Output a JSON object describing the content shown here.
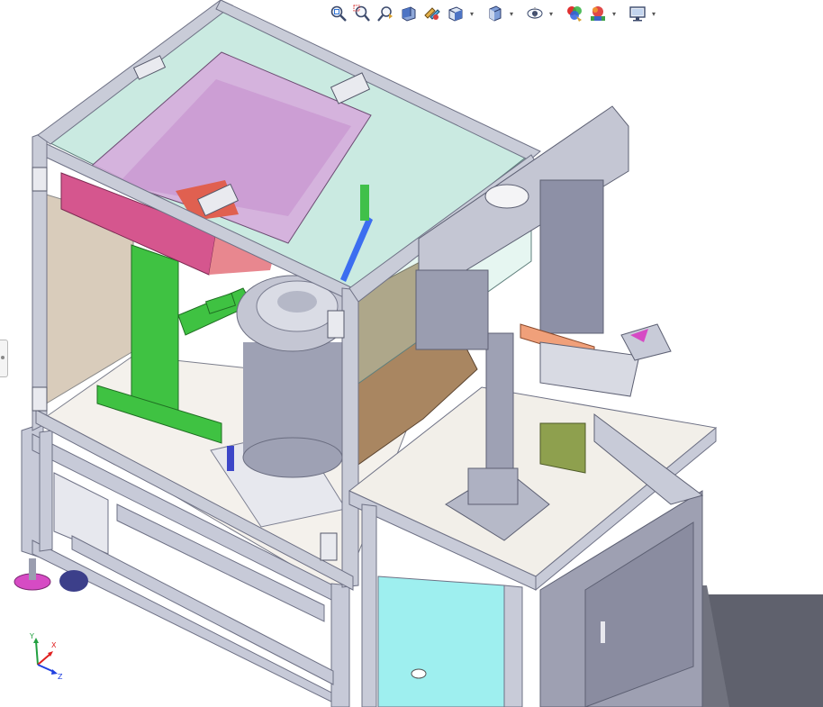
{
  "toolbar": {
    "tools": [
      {
        "id": "zoom-to-fit",
        "icon": "zoom-to-fit-icon"
      },
      {
        "id": "zoom-to-area",
        "icon": "zoom-to-area-icon"
      },
      {
        "id": "previous-view",
        "icon": "previous-view-icon"
      },
      {
        "id": "section-view",
        "icon": "section-view-icon"
      },
      {
        "id": "dynamic-annotation",
        "icon": "dynamic-annotation-icon"
      },
      {
        "id": "view-orientation",
        "icon": "view-orientation-icon",
        "dropdown": true
      },
      {
        "id": "display-style",
        "icon": "display-style-icon",
        "dropdown": true
      },
      {
        "id": "hide-show-items",
        "icon": "hide-show-items-icon",
        "dropdown": true
      },
      {
        "id": "edit-appearance",
        "icon": "edit-appearance-icon"
      },
      {
        "id": "apply-scene",
        "icon": "apply-scene-icon",
        "dropdown": true
      },
      {
        "id": "view-settings",
        "icon": "view-settings-icon",
        "dropdown": true
      }
    ]
  },
  "triad": {
    "x_label": "X",
    "y_label": "Y",
    "z_label": "Z",
    "colors": {
      "x": "#e02020",
      "y": "#22a040",
      "z": "#2040e0"
    }
  },
  "colors": {
    "frame": "#c9ccd8",
    "frame_dark": "#8d90a6",
    "glass": "#9fd8c9",
    "hopper": "#d7a9dc",
    "pink": "#d5568e",
    "green": "#3fc242",
    "bowl": "#a9acba",
    "panel": "#b9946f",
    "table": "#f2efe9",
    "cyan": "#9eefef",
    "magenta": "#d64bc4"
  }
}
